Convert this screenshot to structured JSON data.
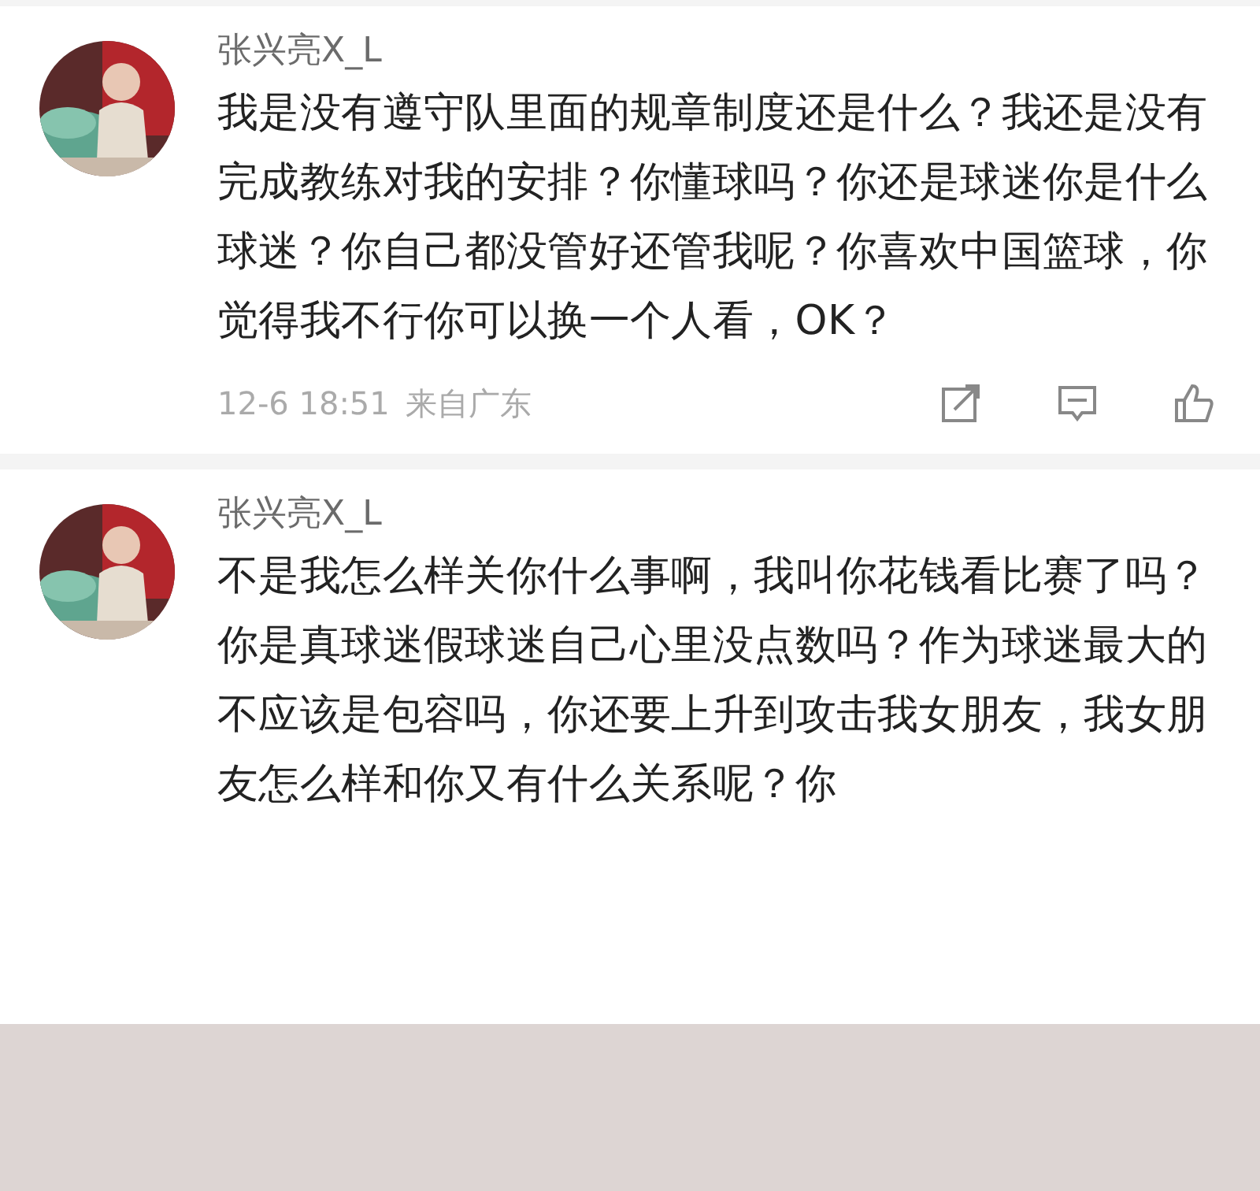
{
  "comments": [
    {
      "author": "张兴亮X_L",
      "text": "我是没有遵守队里面的规章制度还是什么？我还是没有完成教练对我的安排？你懂球吗？你还是球迷你是什么球迷？你自己都没管好还管我呢？你喜欢中国篮球，你觉得我不行你可以换一个人看，OK？",
      "footer": {
        "time": "12-6 18:51",
        "source": "来自广东"
      }
    },
    {
      "author": "张兴亮X_L",
      "text": "不是我怎么样关你什么事啊，我叫你花钱看比赛了吗？你是真球迷假球迷自己心里没点数吗？作为球迷最大的不应该是包容吗，你还要上升到攻击我女朋友，我女朋友怎么样和你又有什么关系呢？你"
    }
  ]
}
